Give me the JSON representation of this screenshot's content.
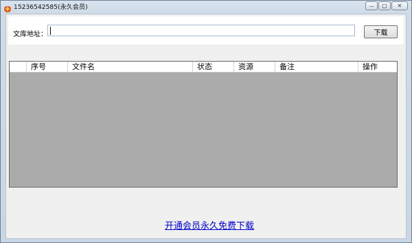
{
  "window": {
    "title": "15236542585(永久会员)",
    "controls": {
      "minimize": "—",
      "maximize": "□",
      "close": "✕"
    }
  },
  "address": {
    "label": "文库地址：",
    "value": "",
    "download_button": "下载"
  },
  "table": {
    "columns": [
      "",
      "序号",
      "文件名",
      "状态",
      "资源",
      "备注",
      "操作"
    ],
    "rows": []
  },
  "footer": {
    "link_text": "开通会员永久免费下载"
  }
}
